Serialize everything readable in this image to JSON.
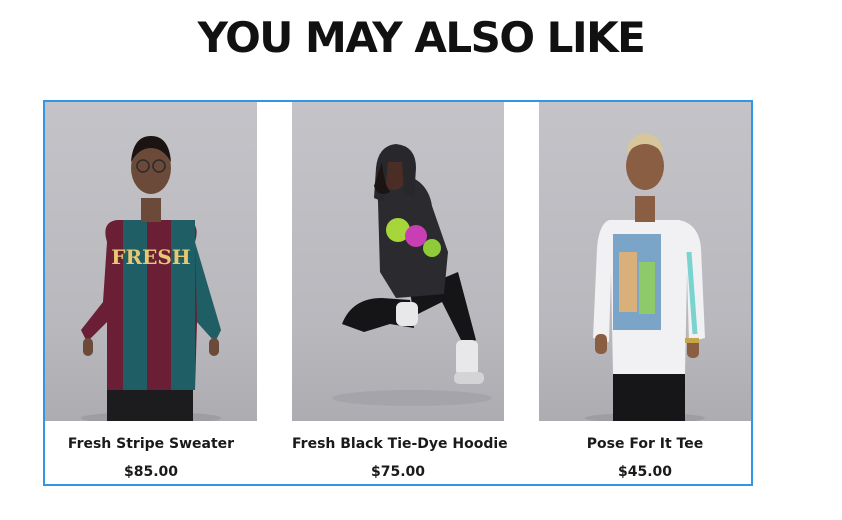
{
  "section": {
    "title": "YOU MAY ALSO LIKE"
  },
  "colors": {
    "carousel_border": "#2f96e8",
    "text": "#111111"
  },
  "products": [
    {
      "name": "Fresh Stripe Sweater",
      "price": "$85.00",
      "image_icon": "model-in-striped-sweater-photo",
      "graphic_text": "FRESH"
    },
    {
      "name": "Fresh Black Tie-Dye Hoodie",
      "price": "$75.00",
      "image_icon": "model-in-tie-dye-hoodie-photo"
    },
    {
      "name": "Pose For It Tee",
      "price": "$45.00",
      "image_icon": "model-in-graphic-long-sleeve-photo"
    }
  ]
}
